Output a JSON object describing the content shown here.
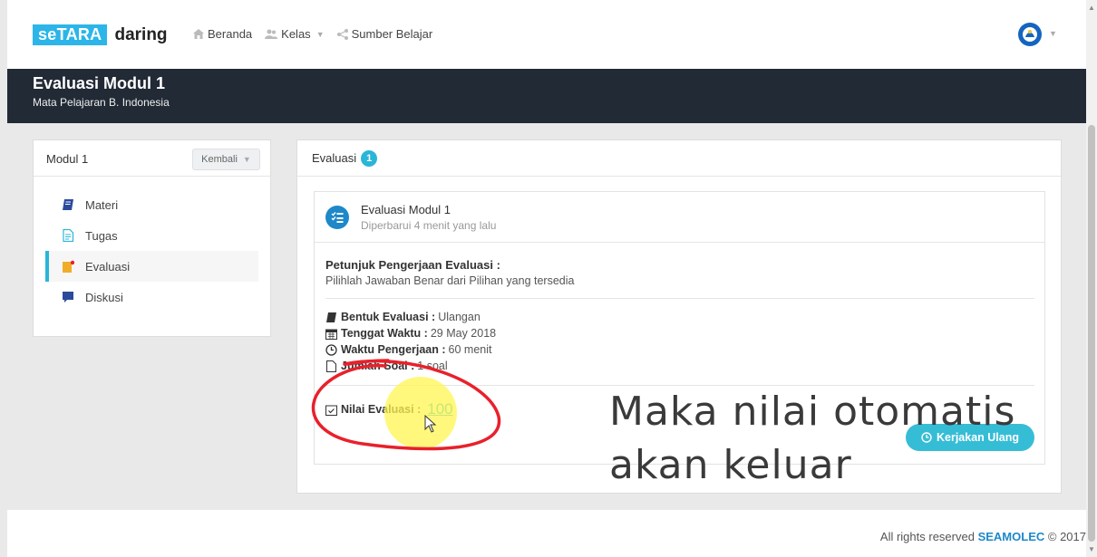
{
  "brand": {
    "logo_left": "seTARA",
    "logo_right": "daring"
  },
  "nav": {
    "items": [
      {
        "label": "Beranda",
        "icon": "home-icon"
      },
      {
        "label": "Kelas",
        "icon": "users-icon",
        "has_caret": true
      },
      {
        "label": "Sumber Belajar",
        "icon": "share-icon"
      }
    ]
  },
  "header": {
    "title": "Evaluasi Modul 1",
    "subtitle": "Mata Pelajaran B. Indonesia"
  },
  "sidebar": {
    "title": "Modul 1",
    "back_button": "Kembali",
    "items": [
      {
        "label": "Materi",
        "icon": "book-icon"
      },
      {
        "label": "Tugas",
        "icon": "document-icon"
      },
      {
        "label": "Evaluasi",
        "icon": "clipboard-icon",
        "active": true
      },
      {
        "label": "Diskusi",
        "icon": "chat-icon"
      }
    ]
  },
  "main": {
    "section_title": "Evaluasi",
    "count": "1",
    "card": {
      "title": "Evaluasi Modul 1",
      "updated": "Diperbarui 4 menit yang lalu",
      "instructions_title": "Petunjuk Pengerjaan Evaluasi :",
      "instructions_text": "Pilihlah Jawaban Benar dari Pilihan yang tersedia",
      "form_label": "Bentuk Evaluasi :",
      "form_value": "Ulangan",
      "deadline_label": "Tenggat Waktu :",
      "deadline_value": "29 May 2018",
      "duration_label": "Waktu Pengerjaan :",
      "duration_value": "60 menit",
      "questions_label": "Jumlah Soal :",
      "questions_value": "1 soal",
      "score_label": "Nilai Evaluasi :",
      "score_value": "100",
      "retry_button": "Kerjakan Ulang"
    }
  },
  "overlay": {
    "line1": "Maka nilai otomatis",
    "line2": "akan keluar"
  },
  "footer": {
    "prefix": "All rights reserved",
    "brand": "SEAMOLEC",
    "suffix": "© 2017"
  },
  "colors": {
    "accent": "#29b6d8",
    "header_bg": "#222a36",
    "annotation_red": "#e8212b",
    "highlight_yellow": "#fff550"
  }
}
